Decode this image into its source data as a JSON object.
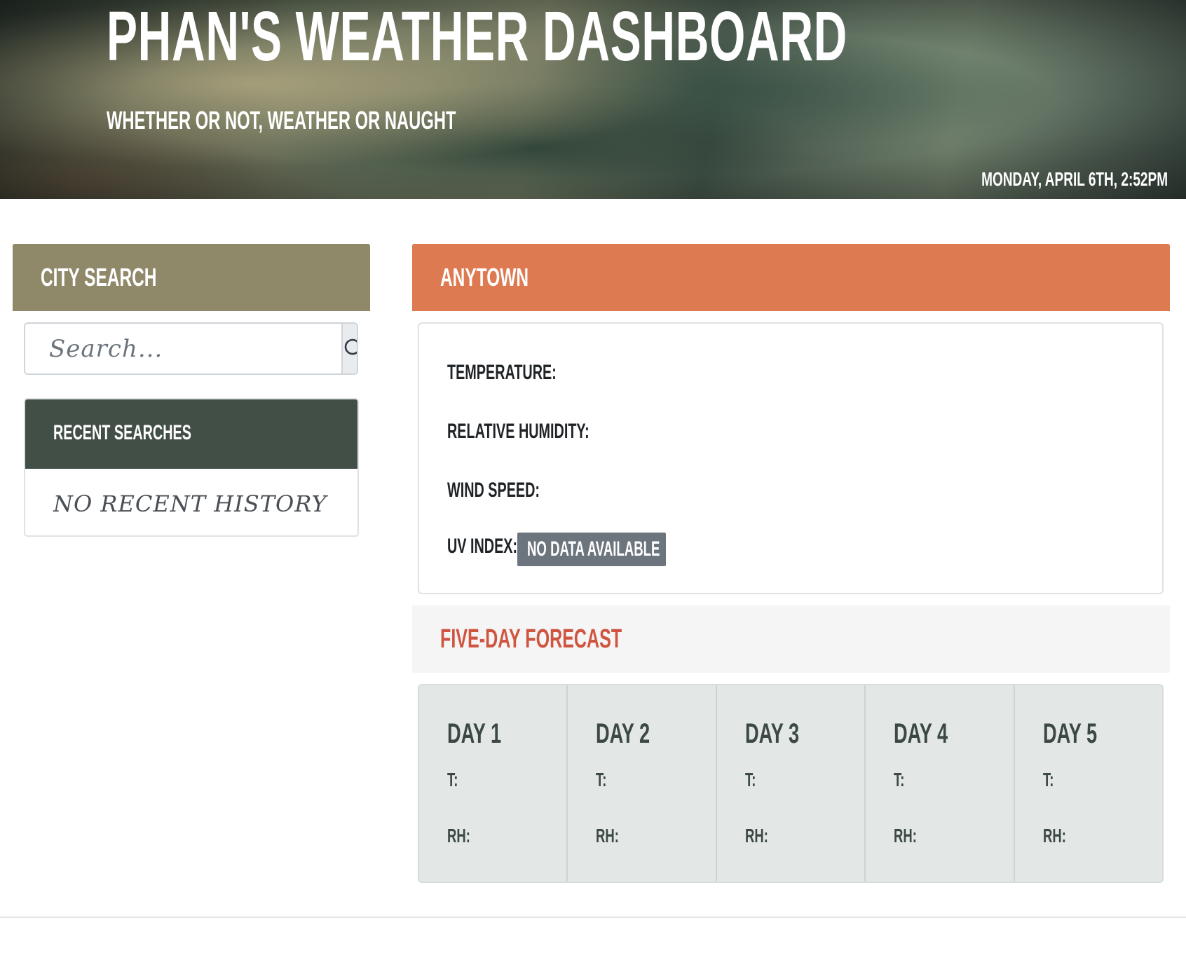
{
  "header": {
    "title": "PHAN'S WEATHER DASHBOARD",
    "subtitle": "WHETHER OR NOT, WEATHER OR NAUGHT",
    "datetime": "MONDAY, APRIL 6TH, 2:52PM"
  },
  "city_search": {
    "title": "CITY SEARCH",
    "placeholder": "Search...",
    "value": "",
    "button_icon": "search-icon"
  },
  "recent_searches": {
    "title": "RECENT SEARCHES",
    "empty_text": "NO RECENT HISTORY"
  },
  "current": {
    "city": "ANYTOWN",
    "temperature_label": "TEMPERATURE:",
    "humidity_label": "RELATIVE HUMIDITY:",
    "wind_label": "WIND SPEED:",
    "uv_label": "UV INDEX:",
    "uv_value": "NO DATA AVAILABLE"
  },
  "forecast": {
    "title": "FIVE-DAY FORECAST",
    "days": [
      {
        "label": "DAY 1",
        "t": "T:",
        "rh": "RH:"
      },
      {
        "label": "DAY 2",
        "t": "T:",
        "rh": "RH:"
      },
      {
        "label": "DAY 3",
        "t": "T:",
        "rh": "RH:"
      },
      {
        "label": "DAY 4",
        "t": "T:",
        "rh": "RH:"
      },
      {
        "label": "DAY 5",
        "t": "T:",
        "rh": "RH:"
      }
    ]
  },
  "colors": {
    "city_search_header": "#8f896a",
    "city_header": "#dd7a51",
    "recent_header": "#414f47",
    "forecast_title": "#cf5540",
    "uv_badge": "#6c757d",
    "forecast_bg": "#e3e8e7"
  }
}
